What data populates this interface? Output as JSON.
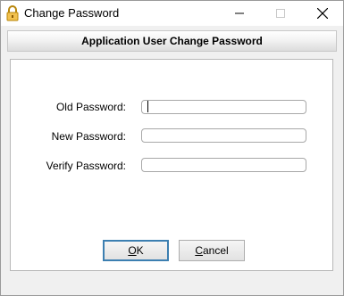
{
  "window": {
    "title": "Change Password",
    "icon": "lock-icon"
  },
  "header": {
    "title": "Application User Change Password"
  },
  "form": {
    "old_password_label": "Old Password:",
    "new_password_label": "New Password:",
    "verify_password_label": "Verify Password:",
    "old_password_value": "",
    "new_password_value": "",
    "verify_password_value": ""
  },
  "buttons": {
    "ok_label": "OK",
    "cancel_label": "Cancel"
  }
}
